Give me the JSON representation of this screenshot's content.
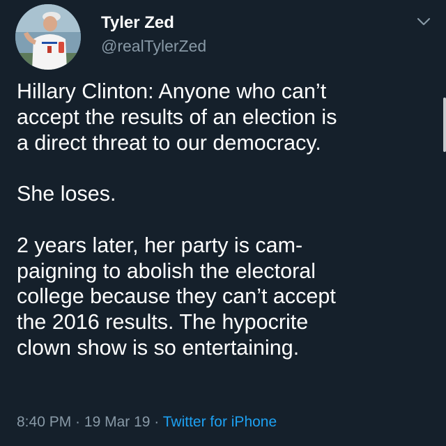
{
  "author": {
    "display_name": "Tyler Zed",
    "handle": "@realTylerZed"
  },
  "menu": {
    "icon": "chevron-down-icon"
  },
  "tweet": {
    "paragraph_1": [
      "Hillary Clinton: Anyone who can’t",
      "accept the results of an election is",
      "a direct threat to our democracy."
    ],
    "paragraph_2": [
      "She loses."
    ],
    "paragraph_3": [
      "2 years later, her party is cam-",
      "paigning to abolish the electoral",
      "college because they can’t accept",
      "the 2016 results. The hypocrite",
      "clown show is so entertaining."
    ]
  },
  "meta": {
    "time": "8:40 PM",
    "separator": " · ",
    "date": "19 Mar 19",
    "source": "Twitter for iPhone"
  },
  "colors": {
    "background": "#15202b",
    "text_primary": "#ffffff",
    "text_secondary": "#8899a6",
    "link": "#1da1f2"
  }
}
